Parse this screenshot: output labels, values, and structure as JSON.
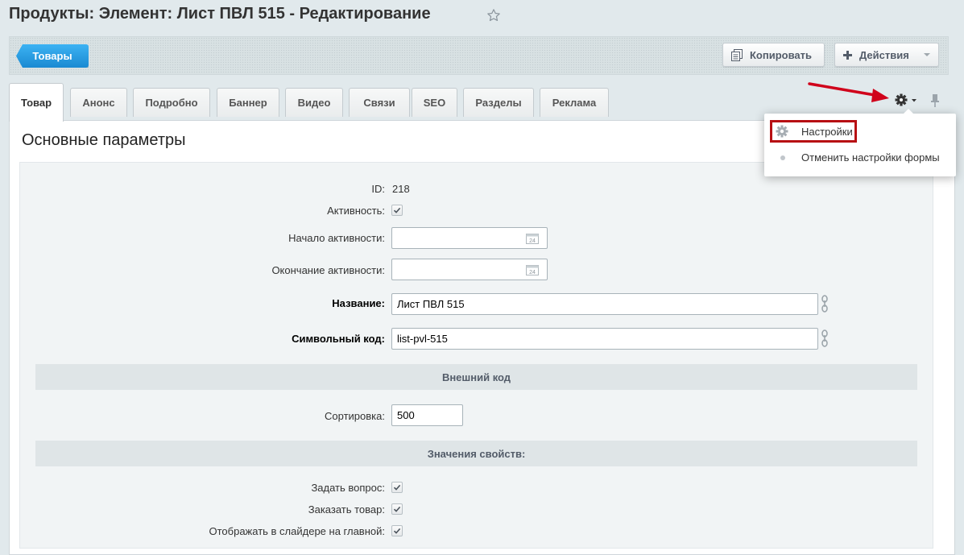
{
  "page": {
    "title": "Продукты: Элемент: Лист ПВЛ 515 - Редактирование"
  },
  "toolbar": {
    "back_label": "Товары",
    "copy_label": "Копировать",
    "actions_label": "Действия"
  },
  "tabs": [
    {
      "label": "Товар",
      "active": true
    },
    {
      "label": "Анонс"
    },
    {
      "label": "Подробно"
    },
    {
      "label": "Баннер"
    },
    {
      "label": "Видео"
    },
    {
      "label": "Связи"
    },
    {
      "label": "SEO"
    },
    {
      "label": "Разделы"
    },
    {
      "label": "Реклама"
    }
  ],
  "settings_menu": {
    "items": [
      {
        "label": "Настройки",
        "highlighted": true
      },
      {
        "label": "Отменить настройки формы"
      }
    ]
  },
  "form": {
    "section_title": "Основные параметры",
    "id_label": "ID:",
    "id_value": "218",
    "active_label": "Активность:",
    "active_checked": true,
    "active_from_label": "Начало активности:",
    "active_from_value": "",
    "active_to_label": "Окончание активности:",
    "active_to_value": "",
    "calendar_day": "24",
    "name_label": "Название:",
    "name_value": "Лист ПВЛ 515",
    "code_label": "Символьный код:",
    "code_value": "list-pvl-515",
    "external_code_header": "Внешний код",
    "sort_label": "Сортировка:",
    "sort_value": "500",
    "properties_header": "Значения свойств:",
    "properties": [
      {
        "label": "Задать вопрос:",
        "checked": true
      },
      {
        "label": "Заказать товар:",
        "checked": true
      },
      {
        "label": "Отображать в слайдере на главной:",
        "checked": true
      }
    ]
  },
  "colors": {
    "accent_blue": "#1a8ad2",
    "highlight_red": "#b70f13",
    "arrow_red": "#d0021b"
  }
}
